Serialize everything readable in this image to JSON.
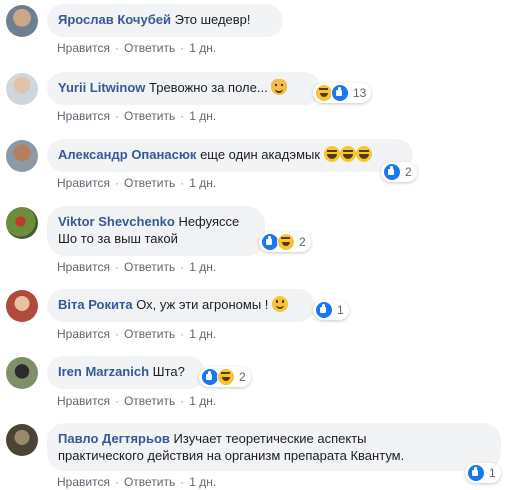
{
  "actions": {
    "like": "Нравится",
    "reply": "Ответить",
    "sep": "·"
  },
  "colors": {
    "author": "#385898",
    "bubble": "#f2f3f5",
    "like_blue": "#1877f2",
    "meta": "#606770"
  },
  "comments": [
    {
      "author": "Ярослав Кочубей",
      "text": "Это шедевр!",
      "time": "1 дн.",
      "reactions": null
    },
    {
      "author": "Yurii Litwinow",
      "text": "Тревожно за поле...",
      "time": "1 дн.",
      "emoji": [
        "smiling-cat-icon"
      ],
      "reactions": {
        "icons": [
          "haha-icon",
          "like-icon"
        ],
        "count": "13"
      }
    },
    {
      "author": "Александр Опанасюк",
      "text": "еще один акадэмык",
      "time": "1 дн.",
      "emoji": [
        "laughing-emoji-icon",
        "laughing-emoji-icon",
        "laughing-emoji-icon"
      ],
      "reactions": {
        "icons": [
          "like-icon"
        ],
        "count": "2"
      }
    },
    {
      "author": "Viktor Shevchenko",
      "text": "Нефуяссе",
      "text2": "Шо то за выш такой",
      "time": "1 дн.",
      "reactions": {
        "icons": [
          "like-icon",
          "haha-icon"
        ],
        "count": "2"
      }
    },
    {
      "author": "Віта Рокита",
      "text": "Ох, уж эти агрономы !",
      "time": "1 дн.",
      "emoji": [
        "smiling-emoji-icon"
      ],
      "reactions": {
        "icons": [
          "like-icon"
        ],
        "count": "1"
      }
    },
    {
      "author": "Iren Marzanich",
      "text": "Шта?",
      "time": "1 дн.",
      "reactions": {
        "icons": [
          "like-icon",
          "haha-icon"
        ],
        "count": "2"
      }
    },
    {
      "author": "Павло Дегтярьов",
      "text": "Изучает теоретические аспекты",
      "text2": "практического действия на организм препарата Квантум.",
      "time": "1 дн.",
      "reactions": {
        "icons": [
          "like-icon"
        ],
        "count": "1"
      }
    }
  ]
}
